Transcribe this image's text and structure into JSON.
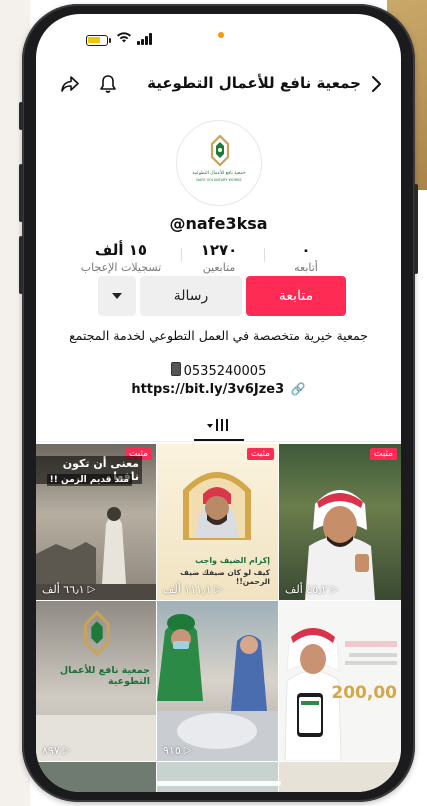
{
  "profile": {
    "title": "جمعية نافع للأعمال التطوعية",
    "handle": "@nafe3ksa",
    "logo_caption_ar": "جمعية نافع للأعمال التطوعية",
    "logo_caption_en": "NAFE VOLUNTARY WORKS"
  },
  "stats": {
    "following": {
      "value": "٠",
      "label": "أتابعه"
    },
    "followers": {
      "value": "١٢٧٠",
      "label": "متابعين"
    },
    "likes": {
      "value": "١٥ ألف",
      "label": "تسجيلات الإعجاب"
    }
  },
  "actions": {
    "follow_label": "متابعة",
    "message_label": "رسالة"
  },
  "bio": {
    "text": "جمعية خيرية متخصصة في العمل التطوعي لخدمة المجتمع",
    "phone": "0535240005",
    "link": "https://bit.ly/3v6Jze3"
  },
  "videos": [
    {
      "pinned": "مثبت",
      "views": "٦٦٫١ ألف",
      "caption": "معنى أن تكون نافعا",
      "caption2": "منذ قديم الزمن !!"
    },
    {
      "pinned": "مثبت",
      "views": "١١١٫١ ألف",
      "caption": "إكرام الضيف واجب",
      "caption2": "كيف لو كان ضيفك ضيف الرحمن!!"
    },
    {
      "pinned": "مثبت",
      "views": "٤٥٫٢ ألف",
      "caption": "",
      "caption2": ""
    },
    {
      "pinned": "",
      "views": "٨٩٧",
      "caption": "جمعية نافع للأعمال التطوعية",
      "caption2": ""
    },
    {
      "pinned": "",
      "views": "٩١٥",
      "caption": "",
      "caption2": ""
    },
    {
      "pinned": "",
      "views": "",
      "caption": "",
      "caption2": "200,00"
    }
  ],
  "colors": {
    "accent": "#fe2c55",
    "text": "#111111",
    "muted": "#777777"
  }
}
